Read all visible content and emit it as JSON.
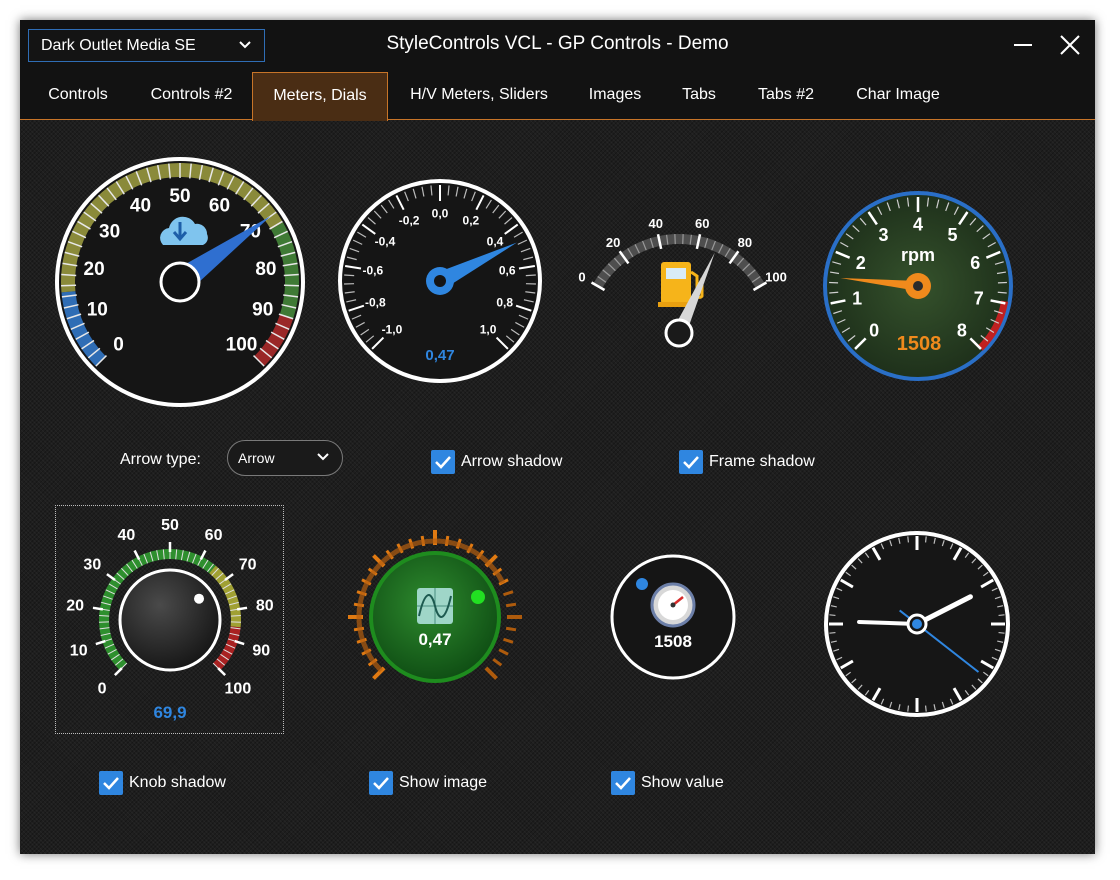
{
  "titlebar": {
    "style_select": "Dark Outlet Media SE",
    "title": "StyleControls VCL - GP Controls - Demo"
  },
  "tabs": [
    {
      "label": "Controls",
      "active": false
    },
    {
      "label": "Controls #2",
      "active": false
    },
    {
      "label": "Meters, Dials",
      "active": true
    },
    {
      "label": "H/V Meters, Sliders",
      "active": false
    },
    {
      "label": "Images",
      "active": false
    },
    {
      "label": "Tabs",
      "active": false
    },
    {
      "label": "Tabs #2",
      "active": false
    },
    {
      "label": "Char Image",
      "active": false
    }
  ],
  "gauges": {
    "speed": {
      "ticks": [
        "0",
        "10",
        "20",
        "30",
        "40",
        "50",
        "60",
        "70",
        "80",
        "90",
        "100"
      ],
      "value": 70,
      "icon": "cloud-download-icon"
    },
    "scale": {
      "ticks": [
        "-1,0",
        "-0,8",
        "-0,6",
        "-0,4",
        "-0,2",
        "0,0",
        "0,2",
        "0,4",
        "0,6",
        "0,8",
        "1,0"
      ],
      "value": 0.47,
      "value_text": "0,47"
    },
    "fuel": {
      "ticks": [
        "0",
        "20",
        "40",
        "60",
        "80",
        "100"
      ],
      "value": 70,
      "icon": "fuel-pump-icon"
    },
    "rpm": {
      "ticks": [
        "0",
        "1",
        "2",
        "3",
        "4",
        "5",
        "6",
        "7",
        "8"
      ],
      "unit": "rpm",
      "value": 1508,
      "value_text": "1508"
    },
    "knob": {
      "ticks": [
        "0",
        "10",
        "20",
        "30",
        "40",
        "50",
        "60",
        "70",
        "80",
        "90",
        "100"
      ],
      "value": 69.9,
      "value_text": "69,9"
    },
    "ring": {
      "value": 0.47,
      "value_text": "0,47",
      "icon": "sine-chart-icon"
    },
    "mini": {
      "value": 1508,
      "value_text": "1508",
      "icon": "speedometer-icon"
    },
    "clock": {
      "hour": 2.4,
      "minute": 10,
      "second": 23
    }
  },
  "controls": {
    "arrow_type_label": "Arrow type:",
    "arrow_type_value": "Arrow",
    "arrow_shadow": {
      "label": "Arrow shadow",
      "checked": true
    },
    "frame_shadow": {
      "label": "Frame shadow",
      "checked": true
    },
    "knob_shadow": {
      "label": "Knob shadow",
      "checked": true
    },
    "show_image": {
      "label": "Show image",
      "checked": true
    },
    "show_value": {
      "label": "Show value",
      "checked": true
    }
  },
  "colors": {
    "accent": "#2f86e0",
    "tab_active_border": "#c77428",
    "orange": "#f08a1c",
    "green": "#2fa02f",
    "red": "#b52020"
  }
}
